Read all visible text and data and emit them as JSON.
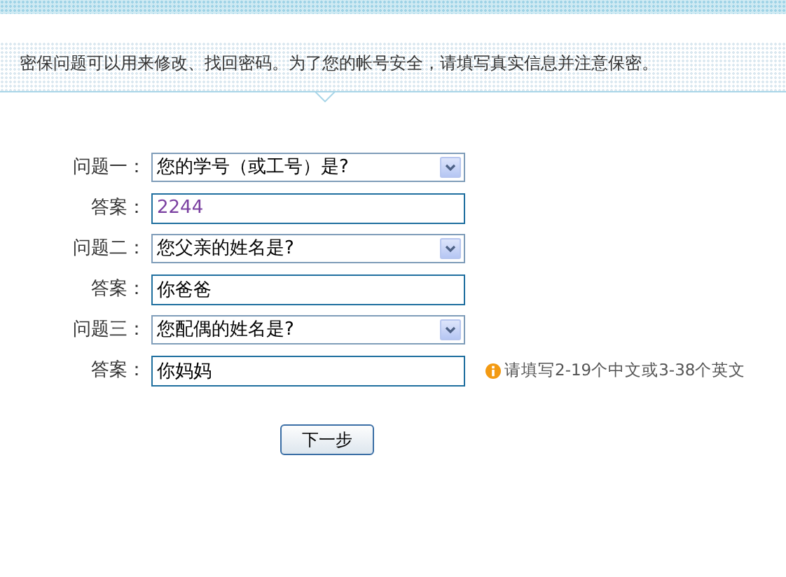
{
  "notice": "密保问题可以用来修改、找回密码。为了您的帐号安全，请填写真实信息并注意保密。",
  "rows": [
    {
      "question_label": "问题一：",
      "question": "您的学号（或工号）是?",
      "answer_label": "答案：",
      "answer": "2244"
    },
    {
      "question_label": "问题二：",
      "question": "您父亲的姓名是?",
      "answer_label": "答案：",
      "answer": "你爸爸"
    },
    {
      "question_label": "问题三：",
      "question": "您配偶的姓名是?",
      "answer_label": "答案：",
      "answer": "你妈妈",
      "hint": "请填写2-19个中文或3-38个英文"
    }
  ],
  "next_button": "下一步"
}
